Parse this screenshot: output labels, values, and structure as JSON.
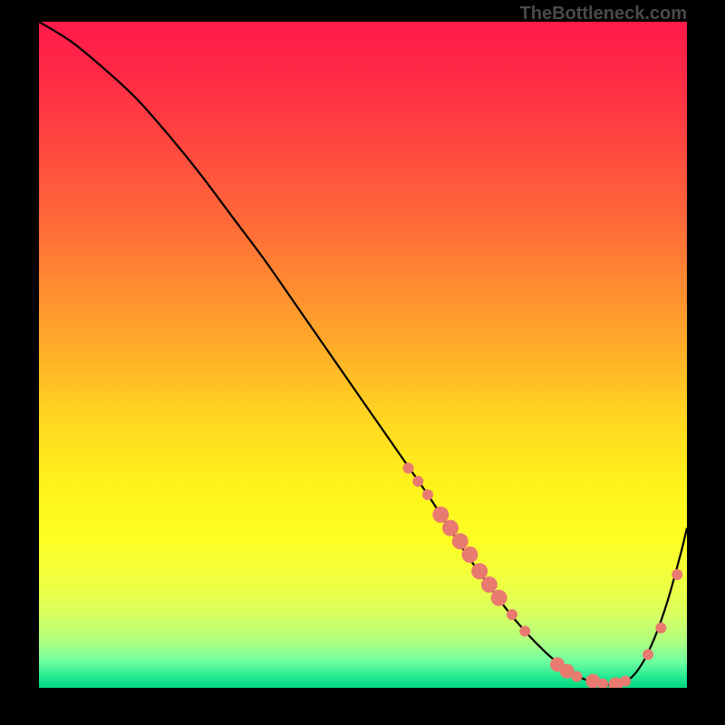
{
  "attribution": "TheBottleneck.com",
  "chart_data": {
    "type": "line",
    "title": "",
    "xlabel": "",
    "ylabel": "",
    "xlim": [
      0,
      100
    ],
    "ylim": [
      0,
      100
    ],
    "background": "rainbow-gradient-vertical",
    "series": [
      {
        "name": "bottleneck-curve",
        "color": "#000000",
        "x": [
          0,
          5,
          10,
          15,
          20,
          25,
          30,
          35,
          40,
          45,
          50,
          55,
          60,
          63,
          66,
          69,
          72,
          75,
          78,
          81,
          83,
          85,
          87,
          89,
          91,
          93,
          95,
          97,
          99,
          100
        ],
        "y": [
          100,
          97,
          93,
          88.5,
          83,
          77,
          70.5,
          64,
          57,
          50,
          43,
          36,
          29,
          24.5,
          20,
          16,
          12,
          8.5,
          5.5,
          3,
          1.8,
          1,
          0.5,
          0.5,
          1.2,
          3.5,
          7.5,
          13,
          20,
          24
        ]
      }
    ],
    "markers": [
      {
        "name": "data-points",
        "color": "#e87a70",
        "shape": "circle",
        "points": [
          {
            "x": 57,
            "y": 33,
            "r": 6
          },
          {
            "x": 58.5,
            "y": 31,
            "r": 6
          },
          {
            "x": 60,
            "y": 29,
            "r": 6
          },
          {
            "x": 62,
            "y": 26,
            "r": 9
          },
          {
            "x": 63.5,
            "y": 24,
            "r": 9
          },
          {
            "x": 65,
            "y": 22,
            "r": 9
          },
          {
            "x": 66.5,
            "y": 20,
            "r": 9
          },
          {
            "x": 68,
            "y": 17.5,
            "r": 9
          },
          {
            "x": 69.5,
            "y": 15.5,
            "r": 9
          },
          {
            "x": 71,
            "y": 13.5,
            "r": 9
          },
          {
            "x": 73,
            "y": 11,
            "r": 6
          },
          {
            "x": 75,
            "y": 8.5,
            "r": 6
          },
          {
            "x": 80,
            "y": 3.5,
            "r": 8
          },
          {
            "x": 81.5,
            "y": 2.5,
            "r": 8
          },
          {
            "x": 83,
            "y": 1.7,
            "r": 6
          },
          {
            "x": 85.5,
            "y": 1,
            "r": 8
          },
          {
            "x": 87,
            "y": 0.6,
            "r": 6
          },
          {
            "x": 89,
            "y": 0.5,
            "r": 8
          },
          {
            "x": 90.5,
            "y": 1,
            "r": 6
          },
          {
            "x": 94,
            "y": 5,
            "r": 6
          },
          {
            "x": 96,
            "y": 9,
            "r": 6
          },
          {
            "x": 98.5,
            "y": 17,
            "r": 6
          }
        ]
      }
    ]
  }
}
